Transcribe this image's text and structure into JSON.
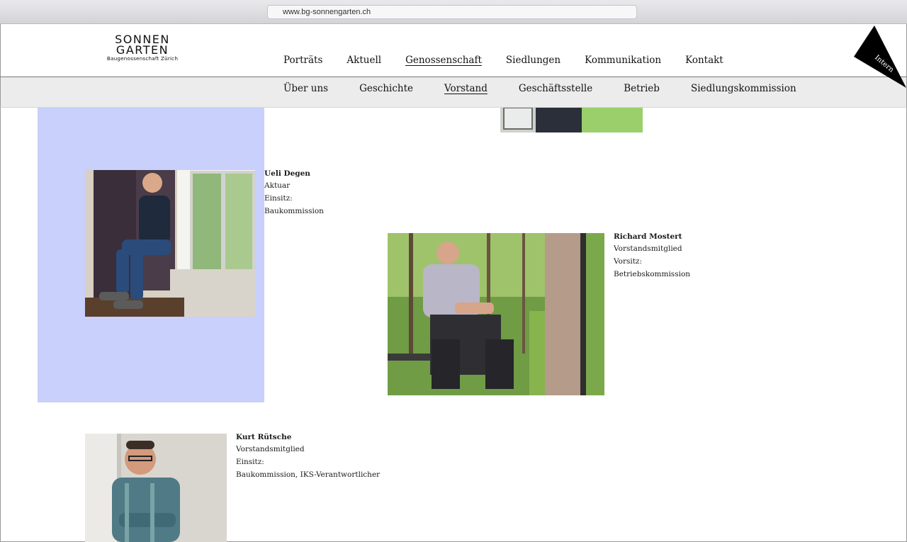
{
  "browser": {
    "url": "www.bg-sonnengarten.ch"
  },
  "logo": {
    "line1": "SONNEN",
    "line2": "GARTEN",
    "line3": "Baugenossenschaft Zürich"
  },
  "main_nav": [
    "Porträts",
    "Aktuell",
    "Genossenschaft",
    "Siedlungen",
    "Kommunikation",
    "Kontakt"
  ],
  "main_nav_active": "Genossenschaft",
  "sub_nav": [
    "Über uns",
    "Geschichte",
    "Vorstand",
    "Geschäftsstelle",
    "Betrieb",
    "Siedlungskommission"
  ],
  "sub_nav_active": "Vorstand",
  "intern_label": "Intern",
  "colors": {
    "accent_block": "#c8d0fb",
    "sub_bar": "#ececec"
  },
  "members": [
    {
      "name": "Ueli Degen",
      "role": "Aktuar",
      "label": "Einsitz:",
      "detail": "Baukommission"
    },
    {
      "name": "Richard Mostert",
      "role": "Vorstandsmitglied",
      "label": "Vorsitz:",
      "detail": "Betriebskommission"
    },
    {
      "name": "Kurt Rütsche",
      "role": "Vorstandsmitglied",
      "label": "Einsitz:",
      "detail": "Baukommission, IKS-Verantwortlicher"
    }
  ]
}
